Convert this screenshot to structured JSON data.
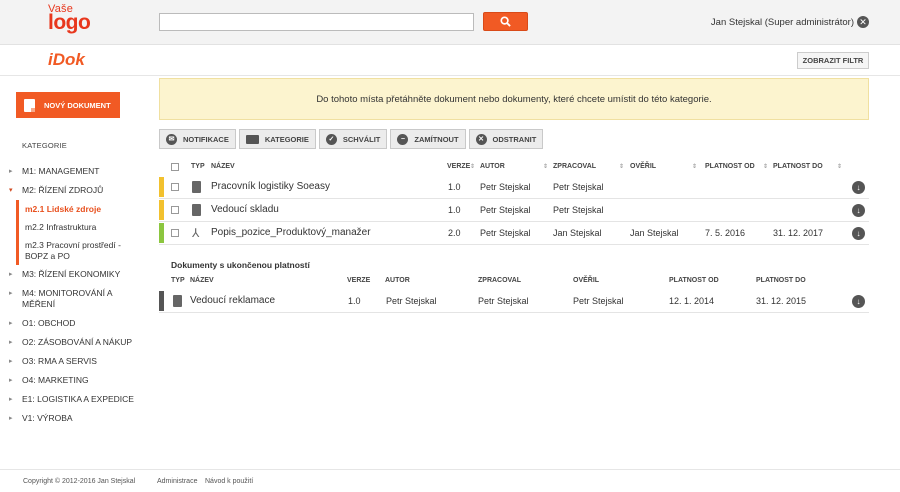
{
  "header": {
    "logo_line1": "Vaše",
    "logo_line2": "logo",
    "search_placeholder": "",
    "user": "Jan Stejskal (Super administrátor)"
  },
  "subheader": {
    "brand": "iDok",
    "filter_button": "ZOBRAZIT FILTR"
  },
  "sidebar": {
    "new_document": "NOVÝ DOKUMENT",
    "categories_title": "KATEGORIE",
    "categories": [
      {
        "label": "M1: MANAGEMENT"
      },
      {
        "label": "M2: ŘÍZENÍ ZDROJŮ",
        "open": true,
        "children": [
          "m2.1 Lidské zdroje",
          "m2.2 Infrastruktura",
          "m2.3 Pracovní prostředí - BOPZ a PO"
        ],
        "active_child": "m2.1 Lidské zdroje"
      },
      {
        "label": "M3: ŘÍZENÍ EKONOMIKY"
      },
      {
        "label": "M4: MONITOROVÁNÍ A MĚŘENÍ"
      },
      {
        "label": "O1: OBCHOD"
      },
      {
        "label": "O2: ZÁSOBOVÁNÍ A NÁKUP"
      },
      {
        "label": "O3: RMA A SERVIS"
      },
      {
        "label": "O4: MARKETING"
      },
      {
        "label": "E1: LOGISTIKA A EXPEDICE"
      },
      {
        "label": "V1: VÝROBA"
      }
    ]
  },
  "dropzone": "Do tohoto místa přetáhněte dokument nebo dokumenty, které chcete umístit do této kategorie.",
  "toolbar": {
    "notify": "NOTIFIKACE",
    "category": "KATEGORIE",
    "approve": "SCHVÁLIT",
    "reject": "ZAMÍTNOUT",
    "remove": "ODSTRANIT"
  },
  "table": {
    "columns": {
      "type": "TYP",
      "name": "NÁZEV",
      "version": "VERZE",
      "author": "AUTOR",
      "processed": "ZPRACOVAL",
      "verified": "OVĚŘIL",
      "valid_from": "PLATNOST OD",
      "valid_to": "PLATNOST DO"
    },
    "rows": [
      {
        "status_color": "#f2c12e",
        "icon": "document-icon",
        "name": "Pracovník logistiky Soeasy",
        "version": "1.0",
        "author": "Petr Stejskal",
        "processed": "Petr Stejskal",
        "verified": "",
        "valid_from": "",
        "valid_to": ""
      },
      {
        "status_color": "#f2c12e",
        "icon": "document-icon",
        "name": "Vedoucí skladu",
        "version": "1.0",
        "author": "Petr Stejskal",
        "processed": "Petr Stejskal",
        "verified": "",
        "valid_from": "",
        "valid_to": ""
      },
      {
        "status_color": "#8cc63f",
        "icon": "pdf-icon",
        "name": "Popis_pozice_Produktový_manažer",
        "version": "2.0",
        "author": "Petr Stejskal",
        "processed": "Jan Stejskal",
        "verified": "Jan Stejskal",
        "valid_from": "7. 5. 2016",
        "valid_to": "31. 12. 2017"
      }
    ]
  },
  "expired": {
    "title": "Dokumenty s ukončenou platností",
    "columns": {
      "type": "TYP",
      "name": "NÁZEV",
      "version": "VERZE",
      "author": "AUTOR",
      "processed": "ZPRACOVAL",
      "verified": "OVĚŘIL",
      "valid_from": "PLATNOST OD",
      "valid_to": "PLATNOST DO"
    },
    "rows": [
      {
        "status_color": "#555555",
        "icon": "document-icon",
        "name": "Vedoucí reklamace",
        "version": "1.0",
        "author": "Petr Stejskal",
        "processed": "Petr Stejskal",
        "verified": "Petr Stejskal",
        "valid_from": "12. 1. 2014",
        "valid_to": "31. 12. 2015"
      }
    ]
  },
  "footer": {
    "copyright": "Copyright © 2012-2016 Jan Stejskal",
    "admin": "Administrace",
    "manual": "Návod k použití"
  }
}
